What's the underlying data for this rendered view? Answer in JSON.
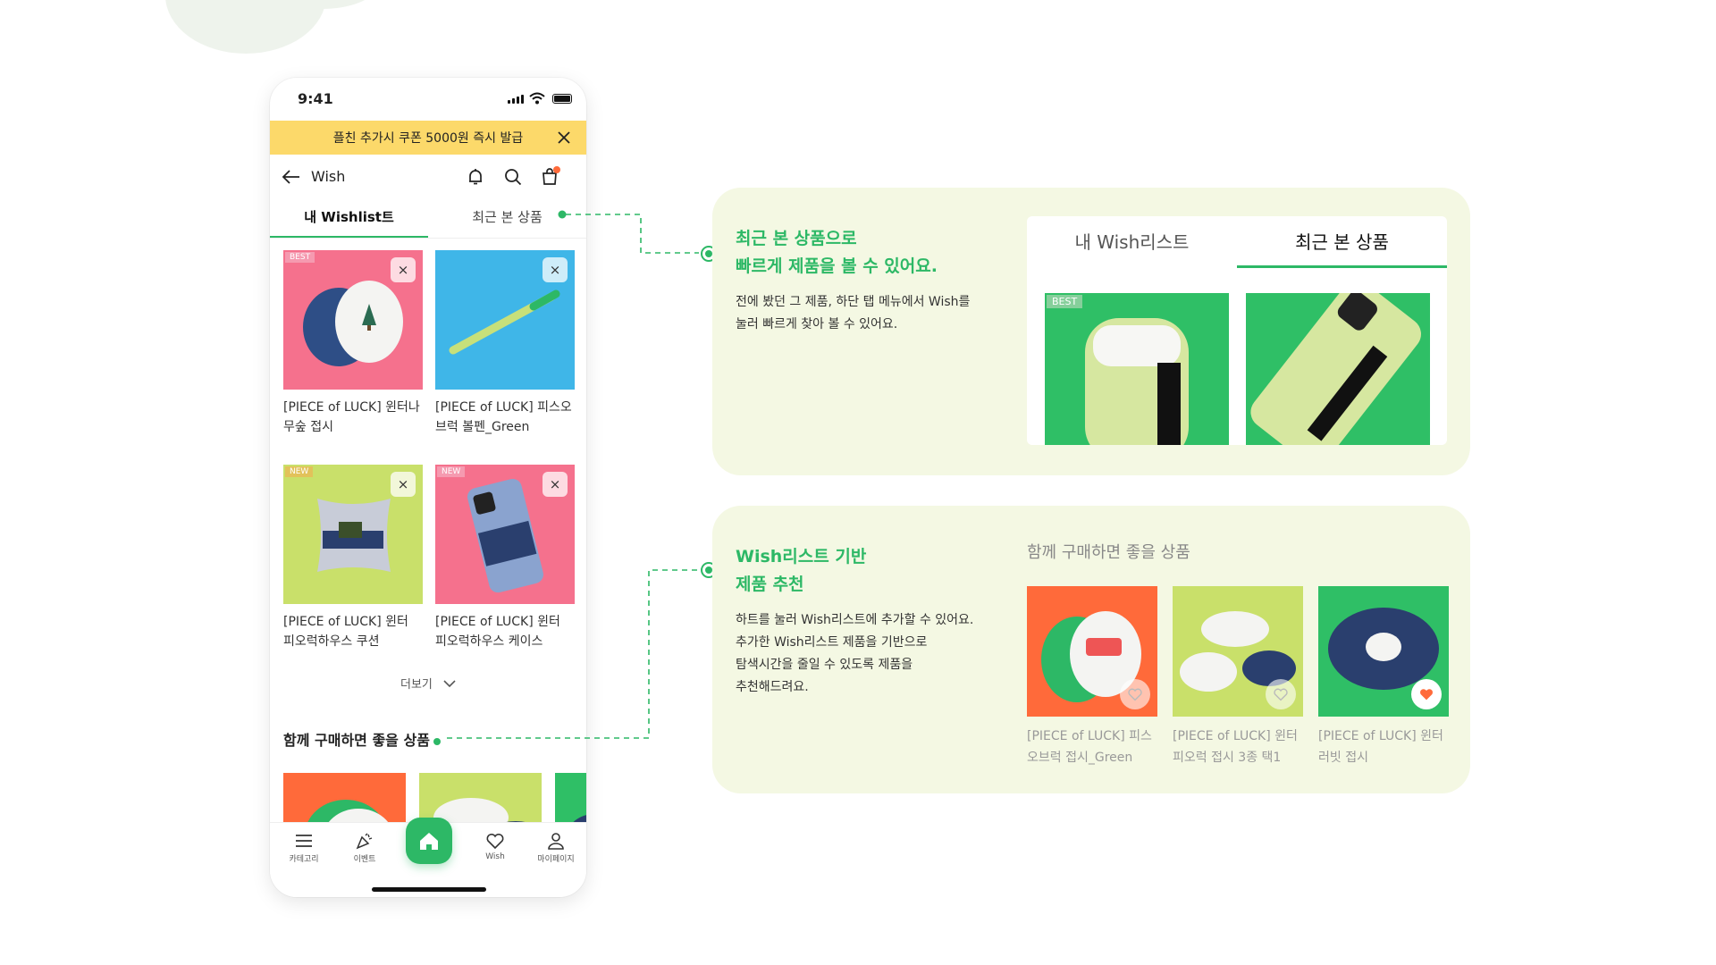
{
  "status": {
    "time": "9:41"
  },
  "banner": {
    "text": "플친 추가시 쿠폰 5000원 즉시 발급"
  },
  "header": {
    "title": "Wish"
  },
  "tabs": {
    "my_wishlist": "내 Wishlist트",
    "recent": "최근 본 상품"
  },
  "wish_items": [
    {
      "tag": "BEST",
      "name": "[PIECE of LUCK] 윈터나무숲 접시"
    },
    {
      "tag": "",
      "name": "[PIECE of LUCK] 피스오브럭 볼펜_Green"
    },
    {
      "tag": "NEW",
      "name": "[PIECE of LUCK] 윈터 피오럭하우스 쿠션"
    },
    {
      "tag": "NEW",
      "name": "[PIECE of LUCK] 윈터 피오럭하우스 케이스"
    }
  ],
  "close_glyph": "×",
  "more": "더보기",
  "together_title": "함께 구매하면 좋을 상품",
  "nav": {
    "category": "카테고리",
    "event": "이벤트",
    "wish": "Wish",
    "mypage": "마이페이지"
  },
  "panel1": {
    "title_line1": "최근 본 상품으로",
    "title_line2": "빠르게 제품을 볼 수 있어요.",
    "desc_line1": "전에 봤던 그 제품, 하단 탭 메뉴에서 Wish를",
    "desc_line2": "눌러 빠르게 찾아 볼 수 있어요.",
    "tab_my": "내 Wish리스트",
    "tab_recent": "최근 본 상품",
    "pic_tag": "BEST"
  },
  "panel2": {
    "title_line1": "Wish리스트 기반",
    "title_line2": "제품 추천",
    "desc_line1": "하트를 눌러 Wish리스트에 추가할 수 있어요.",
    "desc_line2": "추가한 Wish리스트 제품을 기반으로",
    "desc_line3": "탐색시간을 줄일 수 있도록 제품을",
    "desc_line4": "추천해드려요.",
    "reco_title": "함께 구매하면 좋을 상품",
    "items": [
      {
        "name_line1": "[PIECE of LUCK] 피스",
        "name_line2": "오브럭 접시_Green",
        "liked": false
      },
      {
        "name_line1": "[PIECE of LUCK] 윈터",
        "name_line2": "피오럭 접시 3종 택1",
        "liked": false
      },
      {
        "name_line1": "[PIECE of LUCK] 윈터",
        "name_line2": "러빗 접시",
        "liked": true
      }
    ]
  },
  "colors": {
    "accent": "#2db866",
    "banner": "#fcd96a",
    "panel": "#f4f8e3",
    "pink": "#f5718d",
    "sky": "#3fb6e8",
    "lime": "#c9e06a",
    "orange": "#ff6a3a"
  }
}
